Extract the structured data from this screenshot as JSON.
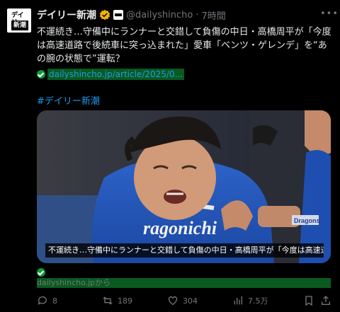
{
  "account": {
    "avatar_line1": "デイリー",
    "avatar_line2": "新潮",
    "name": "デイリー新潮",
    "handle": "@dailyshincho",
    "time": "7時間"
  },
  "post": {
    "text": "不運続き…守備中にランナーと交錯して負傷の中日・高橋周平が「今度は高速道路で後続車に突っ込まれた」愛車「ベンツ・ゲレンデ」を“あの腕の状態で”運転？",
    "link": "dailyshincho.jp/article/2025/0...",
    "hashtag": "#デイリー新潮"
  },
  "media": {
    "caption": "不運続き…守備中にランナーと交錯して負傷の中日・高橋周平が「今度は高速道..."
  },
  "source": {
    "label": "dailyshincho.jpから"
  },
  "actions": {
    "replies": "8",
    "reposts": "189",
    "likes": "304",
    "views": "7.5万"
  },
  "colors": {
    "background": "#000000",
    "text": "#e7e9ea",
    "muted": "#71767b",
    "link": "#1d9bf0",
    "verified": "#f4b400",
    "highlight": "#0a5a1f"
  }
}
